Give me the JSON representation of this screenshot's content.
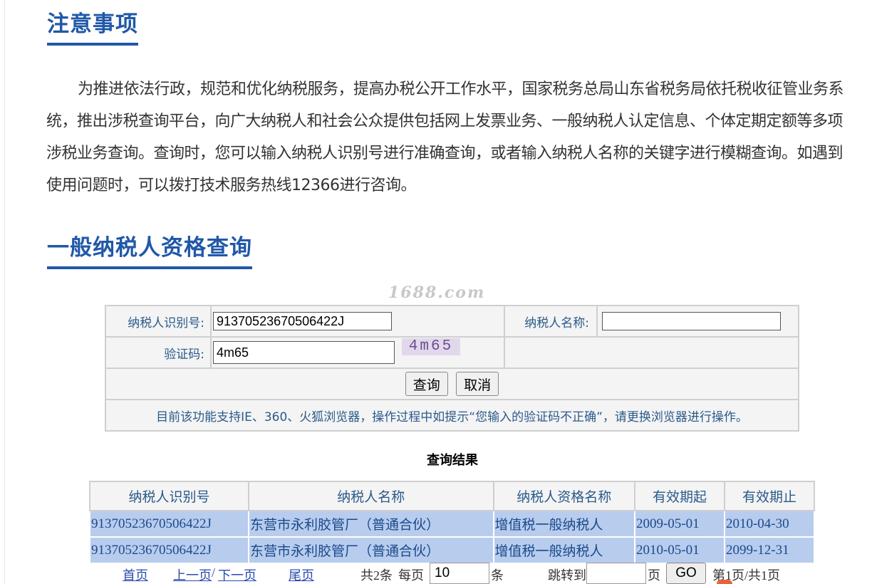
{
  "section1": {
    "title": "注意事项",
    "body": "为推进依法行政，规范和优化纳税服务，提高办税公开工作水平，国家税务总局山东省税务局依托税收征管业务系统，推出涉税查询平台，向广大纳税人和社会公众提供包括网上发票业务、一般纳税人认定信息、个体定期定额等多项涉税业务查询。查询时，您可以输入纳税人识别号进行准确查询，或者输入纳税人名称的关键字进行模糊查询。如遇到使用问题时，可以拨打技术服务热线12366进行咨询。"
  },
  "section2": {
    "title": "一般纳税人资格查询"
  },
  "watermark": "1688.com",
  "form": {
    "taxpayer_id_label": "纳税人识别号:",
    "taxpayer_id_value": "91370523670506422J",
    "taxpayer_name_label": "纳税人名称:",
    "taxpayer_name_value": "",
    "captcha_label": "验证码:",
    "captcha_value": "4m65",
    "captcha_image_text": "4m65",
    "query_button": "查询",
    "cancel_button": "取消",
    "notice": "目前该功能支持IE、360、火狐浏览器，操作过程中如提示“您输入的验证码不正确”，请更换浏览器进行操作。"
  },
  "results": {
    "title": "查询结果",
    "headers": [
      "纳税人识别号",
      "纳税人名称",
      "纳税人资格名称",
      "有效期起",
      "有效期止"
    ],
    "rows": [
      [
        "91370523670506422J",
        "东营市永利胶管厂（普通合伙）",
        "增值税一般纳税人",
        "2009-05-01",
        "2010-04-30"
      ],
      [
        "91370523670506422J",
        "东营市永利胶管厂（普通合伙）",
        "增值税一般纳税人",
        "2010-05-01",
        "2099-12-31"
      ]
    ]
  },
  "pager": {
    "first": "首页",
    "prev": "上一页",
    "sep": "/",
    "next": "下一页",
    "last": "尾页",
    "total": "共2条",
    "per_page_label": "每页",
    "per_page_value": "10",
    "per_page_unit": "条",
    "jump_label": "跳转到",
    "jump_value": "",
    "page_unit": "页",
    "go": "GO",
    "page_info": "第1页/共1页"
  },
  "colors": {
    "heading": "#2058a8",
    "row_bg": "#b8ccee",
    "link": "#2a4ab0"
  }
}
